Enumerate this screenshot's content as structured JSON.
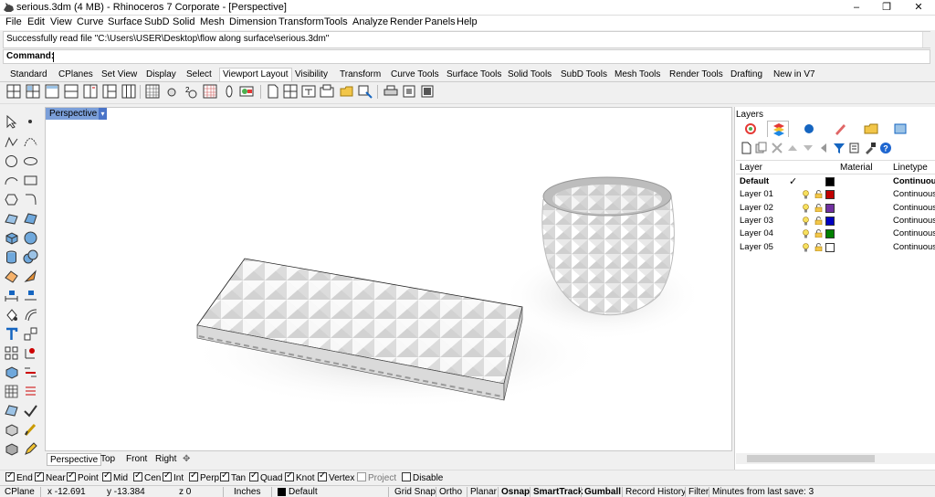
{
  "window": {
    "title": "serious.3dm (4 MB) - Rhinoceros 7 Corporate - [Perspective]",
    "controls": [
      "–",
      "❐",
      "✕"
    ]
  },
  "menu": [
    "File",
    "Edit",
    "View",
    "Curve",
    "Surface",
    "SubD",
    "Solid",
    "Mesh",
    "Dimension",
    "Transform",
    "Tools",
    "Analyze",
    "Render",
    "Panels",
    "Help"
  ],
  "command": {
    "history": "Successfully read file \"C:\\Users\\USER\\Desktop\\flow along surface\\serious.3dm\"",
    "prompt_label": "Command:",
    "value": ""
  },
  "toolbar_tabs": [
    "Standard",
    "CPlanes",
    "Set View",
    "Display",
    "Select",
    "Viewport Layout",
    "Visibility",
    "Transform",
    "Curve Tools",
    "Surface Tools",
    "Solid Tools",
    "SubD Tools",
    "Mesh Tools",
    "Render Tools",
    "Drafting",
    "New in V7"
  ],
  "active_toolbar_tab": "Viewport Layout",
  "viewport": {
    "name": "Perspective",
    "tabs": [
      "Perspective",
      "Top",
      "Front",
      "Right"
    ],
    "add_tab_glyph": "✥"
  },
  "panel": {
    "title": "Layers",
    "columns": [
      "Layer",
      "Material",
      "Linetype"
    ],
    "layers": [
      {
        "name": "Default",
        "current": true,
        "check": "✓",
        "color": "#000000",
        "linetype": "Continuous"
      },
      {
        "name": "Layer 01",
        "color": "#c00000",
        "linetype": "Continuous"
      },
      {
        "name": "Layer 02",
        "color": "#7030a0",
        "linetype": "Continuous"
      },
      {
        "name": "Layer 03",
        "color": "#0000c0",
        "linetype": "Continuous"
      },
      {
        "name": "Layer 04",
        "color": "#008000",
        "linetype": "Continuous"
      },
      {
        "name": "Layer 05",
        "color": "#ffffff",
        "linetype": "Continuous"
      }
    ]
  },
  "osnaps": [
    {
      "label": "End",
      "on": true
    },
    {
      "label": "Near",
      "on": true
    },
    {
      "label": "Point",
      "on": true
    },
    {
      "label": "Mid",
      "on": true
    },
    {
      "label": "Cen",
      "on": true
    },
    {
      "label": "Int",
      "on": true
    },
    {
      "label": "Perp",
      "on": true
    },
    {
      "label": "Tan",
      "on": true
    },
    {
      "label": "Quad",
      "on": true
    },
    {
      "label": "Knot",
      "on": true
    },
    {
      "label": "Vertex",
      "on": true
    },
    {
      "label": "Project",
      "on": false,
      "disabled": true
    },
    {
      "label": "Disable",
      "on": false
    }
  ],
  "status": {
    "cplane": "CPlane",
    "x": "x -12.691",
    "y": "y -13.384",
    "z": "z 0",
    "units": "Inches",
    "layer": "Default",
    "toggles": [
      "Grid Snap",
      "Ortho",
      "Planar",
      "Osnap",
      "SmartTrack",
      "Gumball",
      "Record History",
      "Filter"
    ],
    "bold_toggles": [
      "Osnap",
      "SmartTrack",
      "Gumball"
    ],
    "save_info": "Minutes from last save: 3"
  }
}
